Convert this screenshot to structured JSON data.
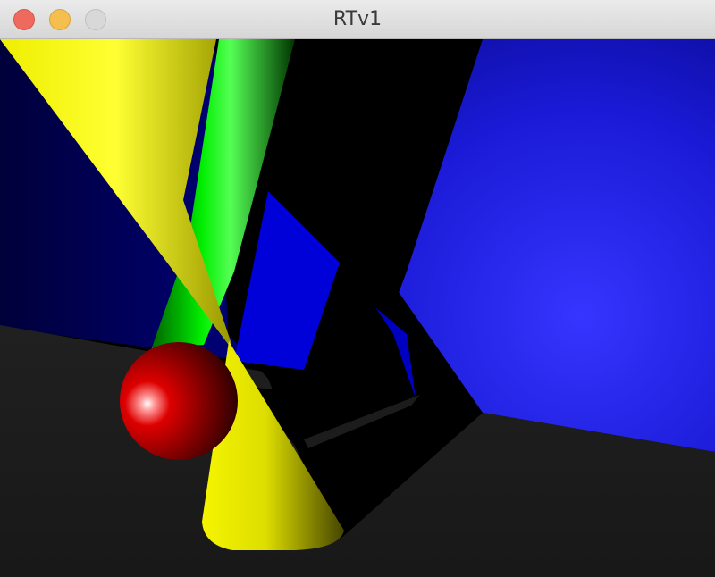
{
  "window": {
    "title": "RTv1"
  },
  "colors": {
    "wall_blue": "#2b2bff",
    "wall_dark": "#00003a",
    "floor": "#1c1c1c",
    "cone_yellow": "#ffff00",
    "cylinder_green": "#00dd00",
    "sphere_red": "#c00000"
  },
  "scene": {
    "objects": [
      "plane",
      "plane",
      "cone",
      "cylinder",
      "sphere"
    ]
  }
}
